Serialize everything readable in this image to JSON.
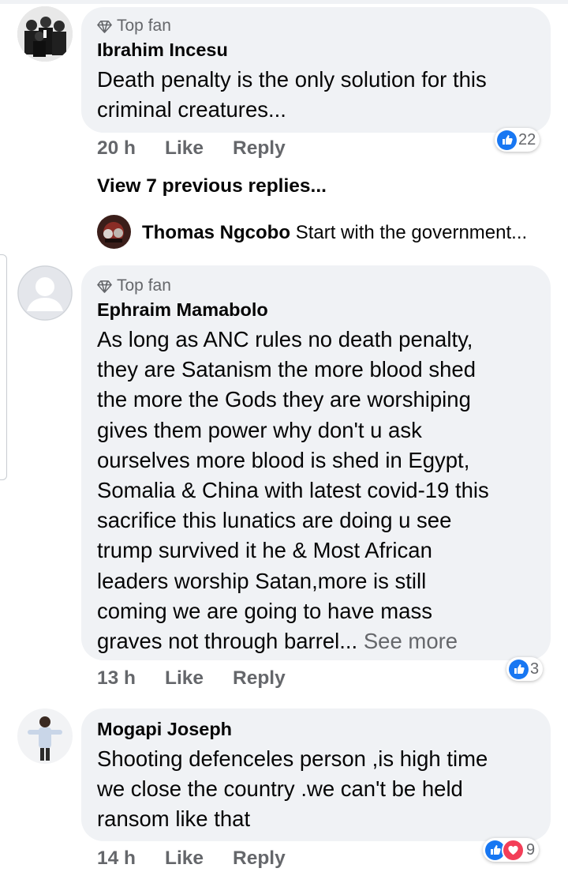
{
  "comments": [
    {
      "badge": "Top fan",
      "author": "Ibrahim Incesu",
      "lines": [
        "Death penalty is the only solution for this",
        "criminal creatures..."
      ],
      "time": "20 h",
      "like_label": "Like",
      "reply_label": "Reply",
      "reaction_count": "22",
      "reactions": [
        "like-icon"
      ]
    },
    {
      "badge": "Top fan",
      "author": "Ephraim Mamabolo",
      "lines": [
        "As long as ANC rules no death penalty,",
        "they are Satanism the more blood shed",
        "the more the Gods they are worshiping",
        "gives them power why don't u ask",
        "ourselves more blood is shed in Egypt,",
        "Somalia & China with latest covid-19 this",
        "sacrifice this lunatics are doing u see",
        "trump survived it he & Most African",
        "leaders worship Satan,more is still",
        "coming we are going to have mass",
        "graves not through barrel..."
      ],
      "see_more": "See more",
      "time": "13 h",
      "like_label": "Like",
      "reply_label": "Reply",
      "reaction_count": "3",
      "reactions": [
        "like-icon"
      ]
    },
    {
      "author": "Mogapi Joseph",
      "lines": [
        "Shooting defenceles person ,is high time",
        "we close the country .we can't be held",
        "ransom like that"
      ],
      "time": "14 h",
      "like_label": "Like",
      "reply_label": "Reply",
      "reaction_count": "9",
      "reactions": [
        "like-icon",
        "love-icon"
      ]
    }
  ],
  "view_previous": "View 7 previous replies...",
  "reply_preview": {
    "author": "Thomas Ngcobo",
    "text": "Start with the government..."
  },
  "colors": {
    "bubble": "#f0f2f5",
    "secondary_text": "#65676b",
    "like_blue": "#1877f2",
    "love_red": "#f33e58"
  }
}
